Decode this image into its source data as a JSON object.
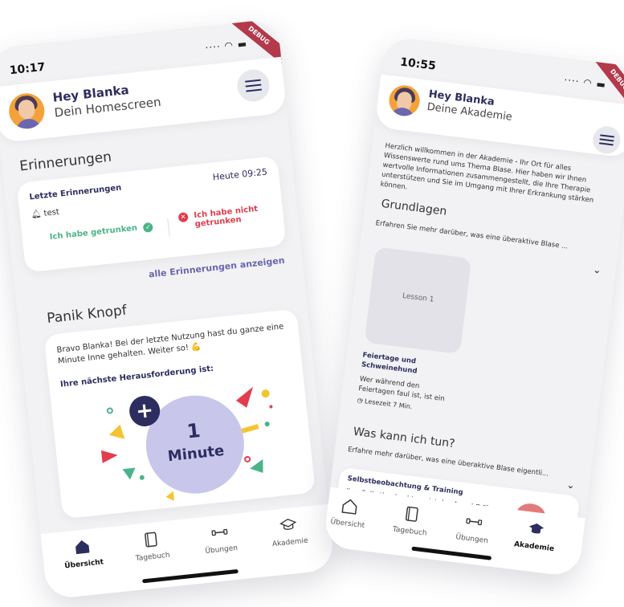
{
  "phone_home": {
    "status": {
      "time": "10:17",
      "debug": "DEBUG"
    },
    "header": {
      "title": "Hey Blanka",
      "subtitle": "Dein Homescreen"
    },
    "reminders": {
      "section_title": "Erinnerungen",
      "card_title": "Letzte Erinnerungen",
      "time": "Heute 09:25",
      "item": "test",
      "drank_label": "Ich habe getrunken",
      "not_drank_label": "Ich habe nicht getrunken",
      "show_all": "alle Erinnerungen anzeigen"
    },
    "panic": {
      "section_title": "Panik Knopf",
      "message": "Bravo Blanka! Bei der letzte Nutzung hast du ganze eine Minute Inne gehalten. Weiter so! 💪",
      "challenge_title": "Ihre nächste Herausforderung ist:",
      "challenge_value": "1",
      "challenge_unit": "Minute",
      "plus": "+"
    },
    "nav": [
      {
        "label": "Übersicht",
        "icon": "house-icon",
        "active": true
      },
      {
        "label": "Tagebuch",
        "icon": "book-icon",
        "active": false
      },
      {
        "label": "Übungen",
        "icon": "dumbbell-icon",
        "active": false
      },
      {
        "label": "Akademie",
        "icon": "graduation-cap-icon",
        "active": false
      }
    ],
    "colors": {
      "accent": "#2d2e5f",
      "green": "#4bb38a",
      "red": "#e23d4d",
      "lavender": "#c9c6ec"
    }
  },
  "phone_academy": {
    "status": {
      "time": "10:55",
      "debug": "DEBUG"
    },
    "header": {
      "title": "Hey Blanka",
      "subtitle": "Deine Akademie"
    },
    "intro": "Herzlich willkommen in der Akademie - Ihr Ort für alles Wissenswerte rund ums Thema Blase. Hier haben wir Ihnen wertvolle Informationen zusammengestellt, die Ihre Therapie unterstützen und Sie im Umgang mit Ihrer Erkrankung stärken können.",
    "sections": [
      {
        "title": "Grundlagen",
        "subtitle": "Erfahren Sie mehr darüber, was eine überaktive Blase ...",
        "lesson": {
          "thumb_label": "Lesson 1",
          "title": "Feiertage und Schweinehund",
          "text": "Wer während den Feiertagen faul ist, ist ein ...",
          "read_time": "Lesezeit 7 Min."
        }
      },
      {
        "title": "Was kann ich tun?",
        "subtitle": "Erfahre mehr darüber, was eine überaktive Blase eigentli..."
      }
    ],
    "teaser": {
      "title": "Selbstbeobachtung & Training",
      "text": "Ihre Selbstbeobachtung ist das A und O für"
    },
    "nav": [
      {
        "label": "Übersicht",
        "icon": "house-icon",
        "active": false
      },
      {
        "label": "Tagebuch",
        "icon": "book-icon",
        "active": false
      },
      {
        "label": "Übungen",
        "icon": "dumbbell-icon",
        "active": false
      },
      {
        "label": "Akademie",
        "icon": "graduation-cap-icon",
        "active": true
      }
    ]
  }
}
